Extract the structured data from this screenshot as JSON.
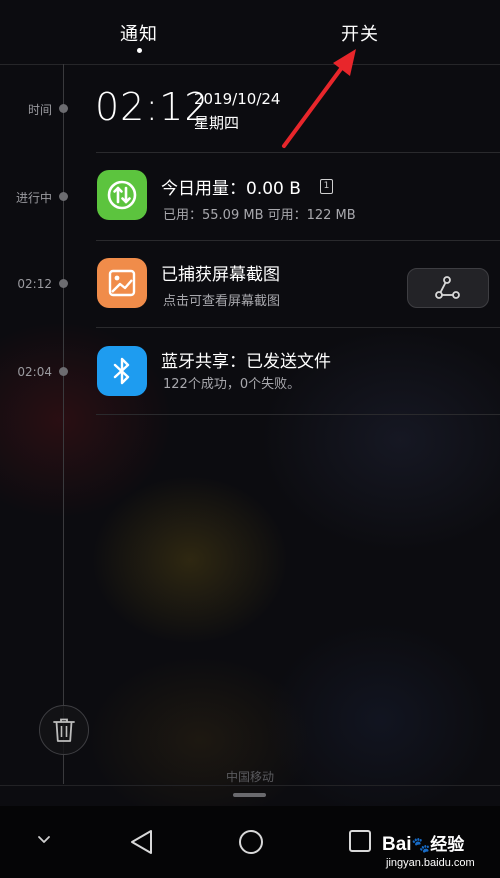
{
  "tabs": {
    "notice_label": "通知",
    "switch_label": "开关"
  },
  "timeline": {
    "time_label": "时间",
    "ongoing_label": "进行中",
    "screenshot_time": "02:12",
    "bluetooth_time": "02:04"
  },
  "clock": {
    "time": "02:12",
    "date": "2019/10/24",
    "weekday": "星期四"
  },
  "notifications": {
    "data_usage": {
      "title": "今日用量：0.00 B",
      "sim_badge": "1",
      "subtitle": "已用：55.09 MB 可用：122 MB",
      "icon_color": "#5cc43e"
    },
    "screenshot": {
      "title": "已捕获屏幕截图",
      "subtitle": "点击可查看屏幕截图",
      "icon_color": "#f08c4a"
    },
    "bluetooth": {
      "title": "蓝牙共享：已发送文件",
      "subtitle": "122个成功，0个失败。",
      "icon_color": "#1e9cf0"
    }
  },
  "carrier": "中国移动",
  "watermark": {
    "logo": "Bai",
    "logo_tail": "经验",
    "url": "jingyan.baidu.com"
  },
  "colors": {
    "annotation_arrow": "#e8262b",
    "background": "#0c0c10"
  }
}
